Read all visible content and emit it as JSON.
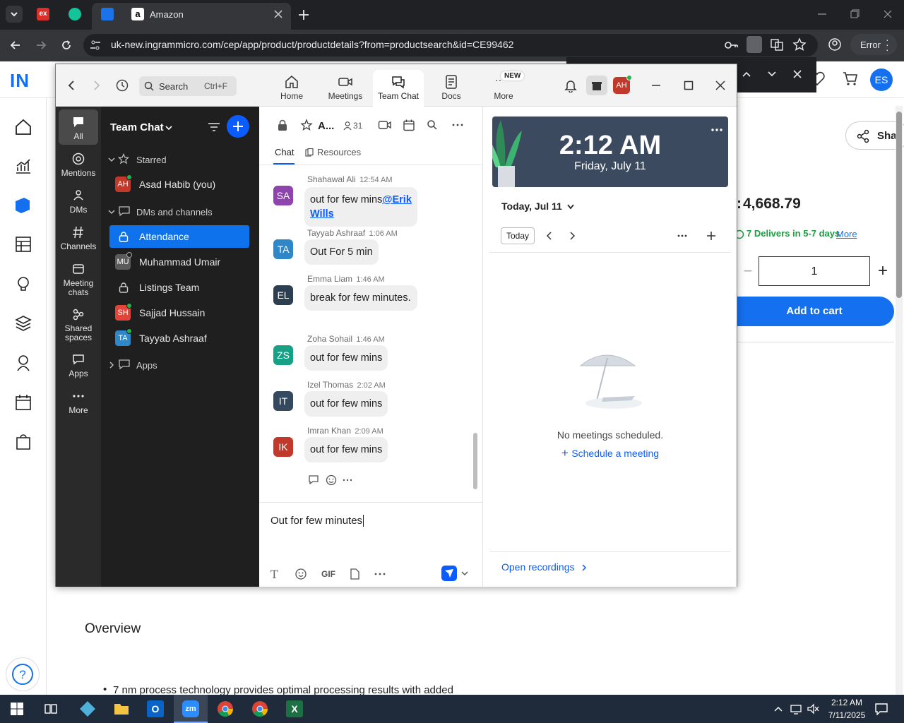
{
  "browser": {
    "tab_title": "Amazon",
    "url": "uk-new.ingrammicro.com/cep/app/product/productdetails?from=productsearch&id=CE99462",
    "error_label": "Error"
  },
  "webpage": {
    "logo_text": "IN",
    "price": "4,668.79",
    "delivery": "7 Delivers in 5-7 days",
    "more_link": "More",
    "quantity": "1",
    "add_to_cart": "Add to cart",
    "share_label": "Sha",
    "user_initials": "ES",
    "overview_title": "Overview",
    "bullet_text": "7 nm process technology provides optimal processing results with added"
  },
  "zoom": {
    "search_placeholder": "Search",
    "search_shortcut": "Ctrl+F",
    "nav": [
      {
        "label": "Home"
      },
      {
        "label": "Meetings"
      },
      {
        "label": "Team Chat"
      },
      {
        "label": "Docs"
      },
      {
        "label": "More",
        "badge": "NEW"
      }
    ],
    "user_initials": "AH",
    "rail": [
      {
        "label": "All"
      },
      {
        "label": "Mentions"
      },
      {
        "label": "DMs"
      },
      {
        "label": "Channels"
      },
      {
        "label": "Meeting chats"
      },
      {
        "label": "Shared spaces"
      },
      {
        "label": "Apps"
      },
      {
        "label": "More"
      }
    ],
    "sidebar": {
      "title": "Team Chat",
      "starred_label": "Starred",
      "starred_item": {
        "initials": "AH",
        "name": "Asad Habib (you)"
      },
      "dms_label": "DMs and channels",
      "items": [
        {
          "name": "Attendance"
        },
        {
          "initials": "MU",
          "name": "Muhammad Umair"
        },
        {
          "name": "Listings Team"
        },
        {
          "initials": "SH",
          "name": "Sajjad Hussain"
        },
        {
          "initials": "TA",
          "name": "Tayyab Ashraaf"
        }
      ],
      "apps_label": "Apps"
    },
    "chat": {
      "channel_name": "A...",
      "member_count": "31",
      "tabs": [
        "Chat",
        "Resources"
      ],
      "messages": [
        {
          "initials": "SA",
          "sender": "Shahawal Ali",
          "time": "12:54 AM",
          "text": "out for few mins",
          "mention": "@Erik Wills"
        },
        {
          "initials": "TA",
          "sender": "Tayyab Ashraaf",
          "time": "1:06 AM",
          "text": "Out For 5 min"
        },
        {
          "initials": "EL",
          "sender": "Emma Liam",
          "time": "1:46 AM",
          "text": "break for few minutes."
        },
        {
          "initials": "ZS",
          "sender": "Zoha Sohail",
          "time": "1:46 AM",
          "text": "out for few mins"
        },
        {
          "initials": "IT",
          "sender": "Izel Thomas",
          "time": "2:02 AM",
          "text": "out for few mins"
        },
        {
          "initials": "IK",
          "sender": "Imran Khan",
          "time": "2:09 AM",
          "text": "out for few mins"
        }
      ],
      "compose_text": "Out for few minutes",
      "gif_label": "GIF"
    },
    "calendar": {
      "time": "2:12 AM",
      "date": "Friday, July 11",
      "today_header": "Today, Jul 11",
      "today_button": "Today",
      "empty_text": "No meetings scheduled.",
      "schedule_link": "Schedule a meeting",
      "recordings_link": "Open recordings"
    }
  },
  "taskbar": {
    "time": "2:12 AM",
    "date": "7/11/2025"
  },
  "colors": {
    "zoom_blue": "#0b5cff",
    "site_blue": "#1a73e8",
    "attendance_selected": "#0e72ed"
  }
}
